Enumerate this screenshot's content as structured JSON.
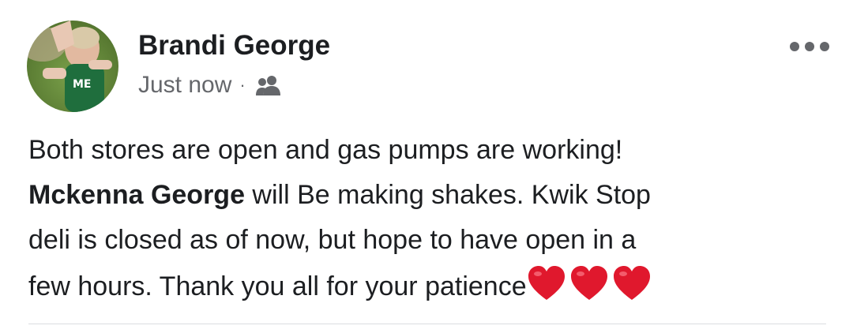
{
  "post": {
    "author": "Brandi George",
    "timestamp": "Just now",
    "separator": "·",
    "audience_icon": "friends-icon",
    "more_icon": "ellipsis-icon",
    "text": {
      "line1": "Both stores are open and gas pumps are working!",
      "mention": "Mckenna George",
      "line2_rest": " will Be making shakes. Kwik Stop",
      "line3": "deli is closed as of now, but hope to have open in a",
      "line4": "few hours. Thank you all for your patience"
    },
    "emoji": [
      "red-heart",
      "red-heart",
      "red-heart"
    ]
  },
  "colors": {
    "text_primary": "#1c1e21",
    "text_secondary": "#65676b",
    "heart": "#e0182d",
    "divider": "#dadde1"
  }
}
